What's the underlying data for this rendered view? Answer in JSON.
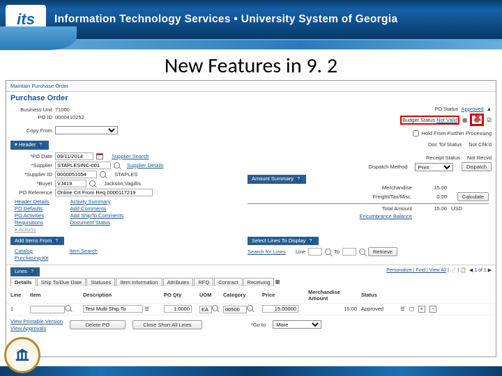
{
  "brand": {
    "logo": "its",
    "text": "Information Technology Services  •  University System of Georgia"
  },
  "slide_title": "New Features in 9. 2",
  "breadcrumb": "Maintain Purchase Order",
  "page_title": "Purchase Order",
  "header_fields": {
    "business_unit_label": "Business Unit",
    "business_unit": "71000",
    "po_id_label": "PO ID",
    "po_id": "0000410252",
    "copy_from_label": "Copy From"
  },
  "status": {
    "po_status_label": "PO Status",
    "po_status": "Approved",
    "budget_status_label": "Budget Status",
    "budget_status": "Not Valid",
    "hold_label": "Hold From Further Processing",
    "doc_tol_label": "Doc Tol Status",
    "doc_tol": "Not Chk'd",
    "receipt_label": "Receipt Status",
    "receipt": "Not Recvd",
    "dispatch_label": "Dispatch Method",
    "dispatch": "Print",
    "dispatch_btn": "Dispatch"
  },
  "header_section": {
    "title": "Header",
    "po_date_label": "*PO Date",
    "po_date": "09/11/2014",
    "supplier_label": "*Supplier",
    "supplier": "STAPLESINC-001",
    "supplier_id_label": "*Supplier ID",
    "supplier_id": "0000051054",
    "buyer_label": "*Buyer",
    "buyer": "VJ419",
    "po_ref_label": "PO Reference",
    "po_ref": "Online Crt From Req 0000117219",
    "supplier_search": "Supplier Search",
    "supplier_details": "Supplier Details",
    "supplier_short": "STAPLES",
    "buyer_name": "Jackson,Vagillis",
    "links": [
      "Header Details",
      "PO Defaults",
      "PO Activities",
      "Requisitions",
      "",
      ""
    ],
    "links2": [
      "Activity Summary",
      "Add Comments",
      "Add ShipTo Comments",
      "Document Status"
    ],
    "actions": "▸ Actions"
  },
  "amount_summary": {
    "title": "Amount Summary",
    "merch_label": "Merchandise",
    "merch": "15.00",
    "freight_label": "Freight/Tax/Misc.",
    "freight": "0.00",
    "total_label": "Total Amount",
    "total": "15.00",
    "currency": "USD",
    "encumb_label": "Encumbrance Balance",
    "calc_btn": "Calculate"
  },
  "add_items": {
    "title": "Add Items From",
    "links": [
      "Catalog",
      "Purchasing Kit",
      "Item Search"
    ]
  },
  "select_lines": {
    "title": "Select Lines To Display",
    "search": "Search for Lines",
    "line_label": "Line",
    "to_label": "To",
    "retrieve": "Retrieve"
  },
  "lines": {
    "title": "Lines",
    "personalize": "Personalize | Find | View All",
    "tabs": [
      "Details",
      "Ship To/Due Date",
      "Statuses",
      "Item Information",
      "Attributes",
      "RFQ",
      "Contract",
      "Receiving"
    ],
    "cols": {
      "line": "Line",
      "item": "Item",
      "desc": "Description",
      "qty": "PO Qty",
      "uom": "UOM",
      "cat": "Category",
      "price": "Price",
      "merch": "Merchandise Amount",
      "status": "Status"
    },
    "row": {
      "line": "1",
      "item": "",
      "desc": "Test Multi Ship To",
      "qty": "1.0000",
      "uom": "EA",
      "cat": "00500",
      "price": "15.00000",
      "merch": "15.00",
      "status": "Approved"
    }
  },
  "footer": {
    "view_printable": "View Printable Version",
    "view_approvals": "View Approvals",
    "delete_po": "Delete PO",
    "close_short": "Close Short All Lines",
    "goto_label": "*Go to",
    "goto": "More"
  }
}
